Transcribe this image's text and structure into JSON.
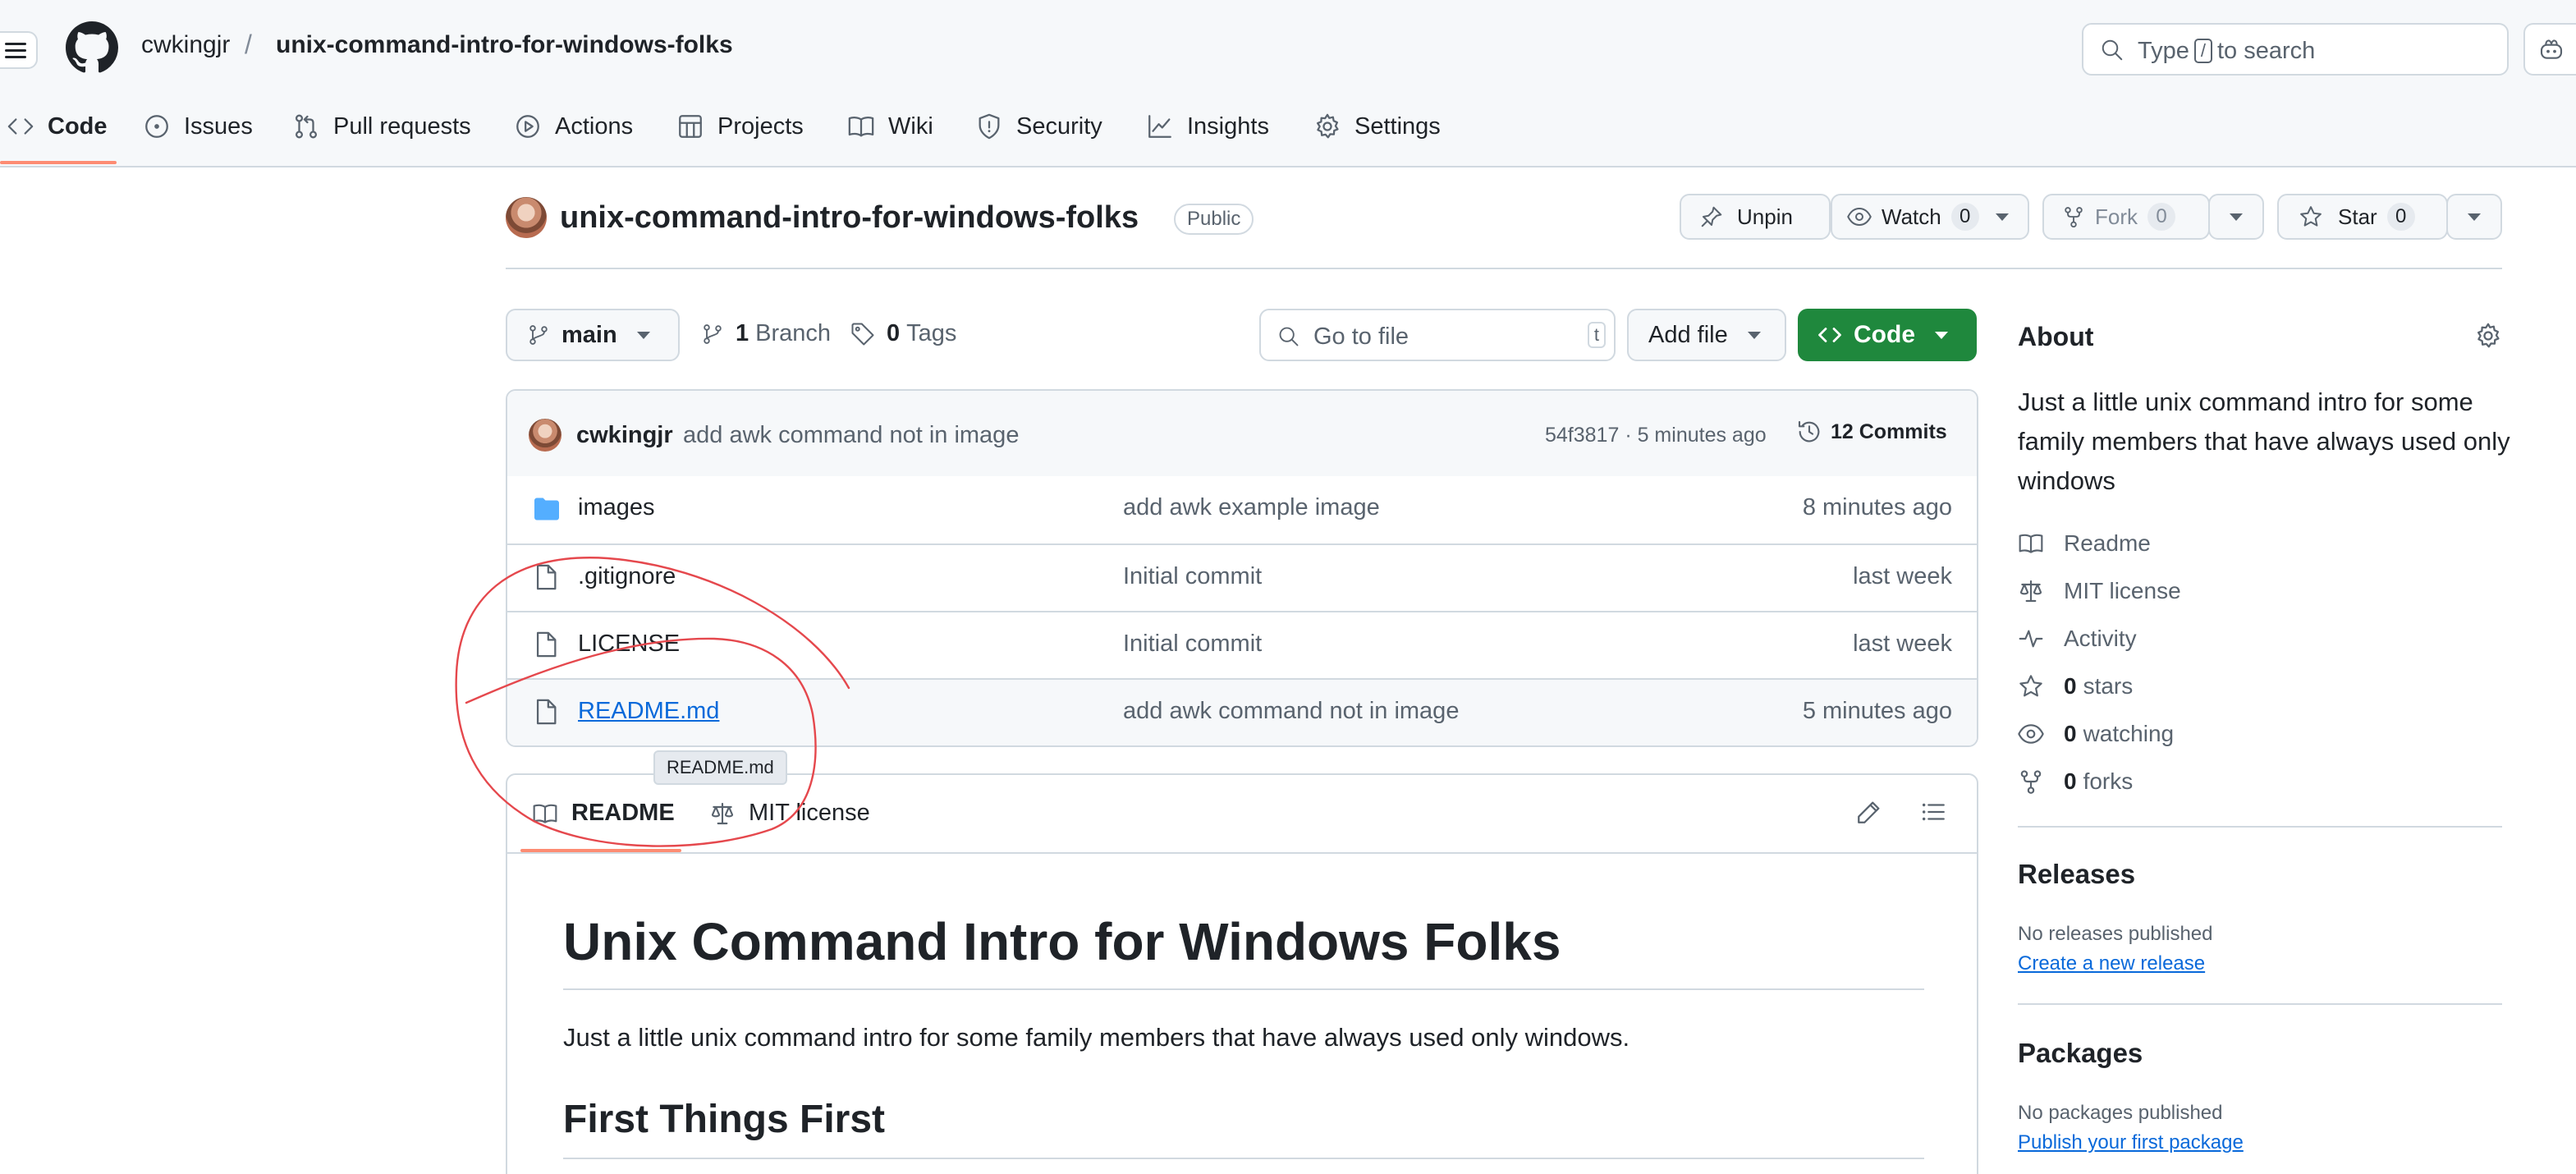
{
  "header": {
    "owner": "cwkingjr",
    "separator": "/",
    "repo": "unix-command-intro-for-windows-folks",
    "search": {
      "pre": "Type",
      "key": "/",
      "post": "to search"
    }
  },
  "nav_tabs": [
    {
      "label": "Code",
      "icon": "code-icon",
      "active": true
    },
    {
      "label": "Issues",
      "icon": "issue-icon"
    },
    {
      "label": "Pull requests",
      "icon": "pull-request-icon"
    },
    {
      "label": "Actions",
      "icon": "play-icon"
    },
    {
      "label": "Projects",
      "icon": "table-icon"
    },
    {
      "label": "Wiki",
      "icon": "book-icon"
    },
    {
      "label": "Security",
      "icon": "shield-icon"
    },
    {
      "label": "Insights",
      "icon": "graph-icon"
    },
    {
      "label": "Settings",
      "icon": "gear-icon"
    }
  ],
  "repo_header": {
    "title": "unix-command-intro-for-windows-folks",
    "visibility": "Public",
    "unpin": "Unpin",
    "watch": "Watch",
    "watch_count": "0",
    "fork": "Fork",
    "fork_count": "0",
    "star": "Star",
    "star_count": "0"
  },
  "branch_bar": {
    "branch": "main",
    "branch_count": "1",
    "branch_label": "Branch",
    "tag_count": "0",
    "tag_label": "Tags",
    "go_to_file": "Go to file",
    "go_to_file_key": "t",
    "add_file": "Add file",
    "code_button": "Code"
  },
  "latest_commit": {
    "author": "cwkingjr",
    "message": "add awk command not in image",
    "sha_time": "54f3817 · 5 minutes ago",
    "commits": "12 Commits"
  },
  "files": [
    {
      "name": "images",
      "type": "folder",
      "message": "add awk example image",
      "date": "8 minutes ago"
    },
    {
      "name": ".gitignore",
      "type": "file",
      "message": "Initial commit",
      "date": "last week"
    },
    {
      "name": "LICENSE",
      "type": "file",
      "message": "Initial commit",
      "date": "last week"
    },
    {
      "name": "README.md",
      "type": "file",
      "message": "add awk command not in image",
      "date": "5 minutes ago"
    }
  ],
  "tooltip": "README.md",
  "readme": {
    "tab_readme": "README",
    "tab_license": "MIT license",
    "h1": "Unix Command Intro for Windows Folks",
    "paragraph": "Just a little unix command intro for some family members that have always used only windows.",
    "h2": "First Things First"
  },
  "about": {
    "heading": "About",
    "description": "Just a little unix command intro for some family members that have always used only windows",
    "readme": "Readme",
    "license": "MIT license",
    "activity": "Activity",
    "stars_count": "0",
    "stars_label": "stars",
    "watching_count": "0",
    "watching_label": "watching",
    "forks_count": "0",
    "forks_label": "forks"
  },
  "releases": {
    "heading": "Releases",
    "none": "No releases published",
    "create": "Create a new release"
  },
  "packages": {
    "heading": "Packages",
    "none": "No packages published",
    "publish": "Publish your first package"
  },
  "colors": {
    "accent_underline": "#fd8c73",
    "code_button": "#1f883d",
    "link": "#0969da",
    "folder_icon": "#54aeff",
    "annotation_ink": "#e5484d"
  }
}
